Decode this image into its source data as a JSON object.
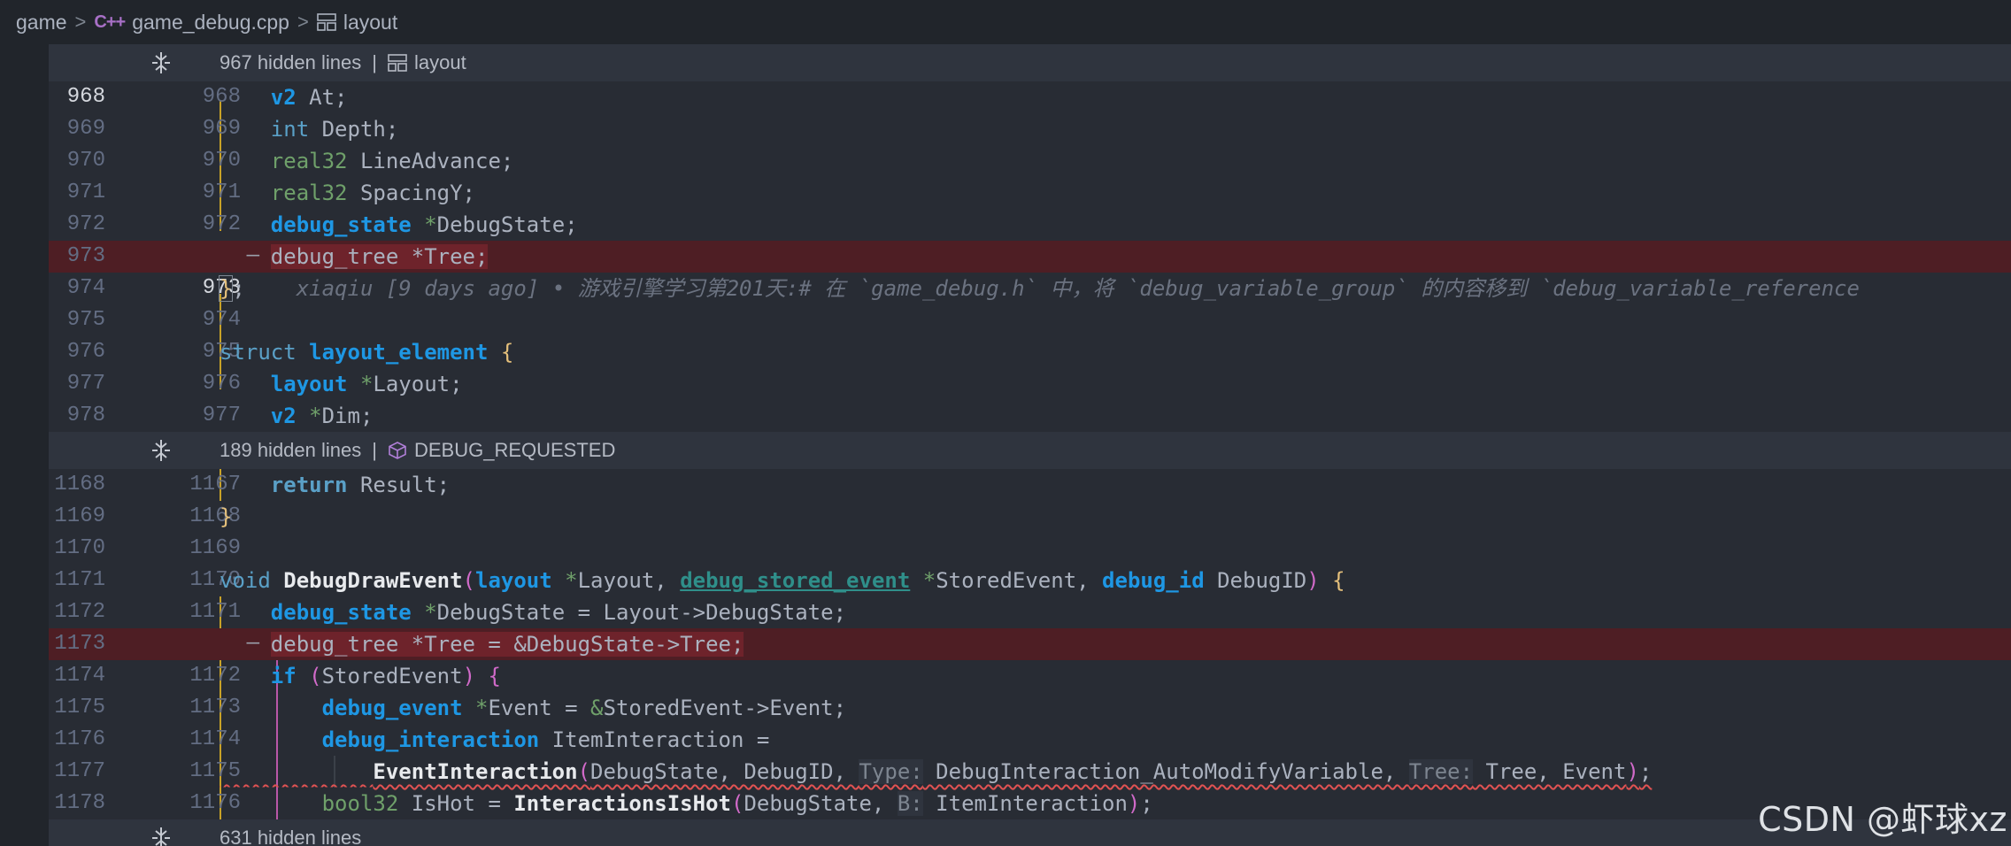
{
  "breadcrumb": {
    "root": "game",
    "file": "game_debug.cpp",
    "file_icon": "C++",
    "symbol": "layout"
  },
  "folds": [
    {
      "count": "967 hidden lines",
      "symbol": "layout",
      "icon": "layout-icon"
    },
    {
      "count": "189 hidden lines",
      "symbol": "DEBUG_REQUESTED",
      "icon": "cube-icon"
    },
    {
      "count": "631 hidden lines",
      "symbol": "",
      "icon": ""
    }
  ],
  "gutter": {
    "g1": [
      {
        "a": "968",
        "b": "968"
      },
      {
        "a": "969",
        "b": "969"
      },
      {
        "a": "970",
        "b": "970"
      },
      {
        "a": "971",
        "b": "971"
      },
      {
        "a": "972",
        "b": "972"
      },
      {
        "a": "973",
        "b": "—"
      },
      {
        "a": "974",
        "b": "973"
      },
      {
        "a": "975",
        "b": "974"
      },
      {
        "a": "976",
        "b": "975"
      },
      {
        "a": "977",
        "b": "976"
      },
      {
        "a": "978",
        "b": "977"
      }
    ],
    "g2": [
      {
        "a": "1168",
        "b": "1167"
      },
      {
        "a": "1169",
        "b": "1168"
      },
      {
        "a": "1170",
        "b": "1169"
      },
      {
        "a": "1171",
        "b": "1170"
      },
      {
        "a": "1172",
        "b": "1171"
      },
      {
        "a": "1173",
        "b": "—"
      },
      {
        "a": "1174",
        "b": "1172"
      },
      {
        "a": "1175",
        "b": "1173"
      },
      {
        "a": "1176",
        "b": "1174"
      },
      {
        "a": "1177",
        "b": "1175"
      },
      {
        "a": "1178",
        "b": "1176"
      }
    ]
  },
  "blame": "xiaqiu [9 days ago] • 游戏引擎学习第201天:# 在 `game_debug.h` 中，将 `debug_variable_group` 的内容移到 `debug_variable_reference",
  "watermark": "CSDN @虾球xz",
  "colors": {
    "deleted_line": "#4e1e24",
    "keyword_type": "#1e97e4",
    "brace": "#e5c07b"
  }
}
